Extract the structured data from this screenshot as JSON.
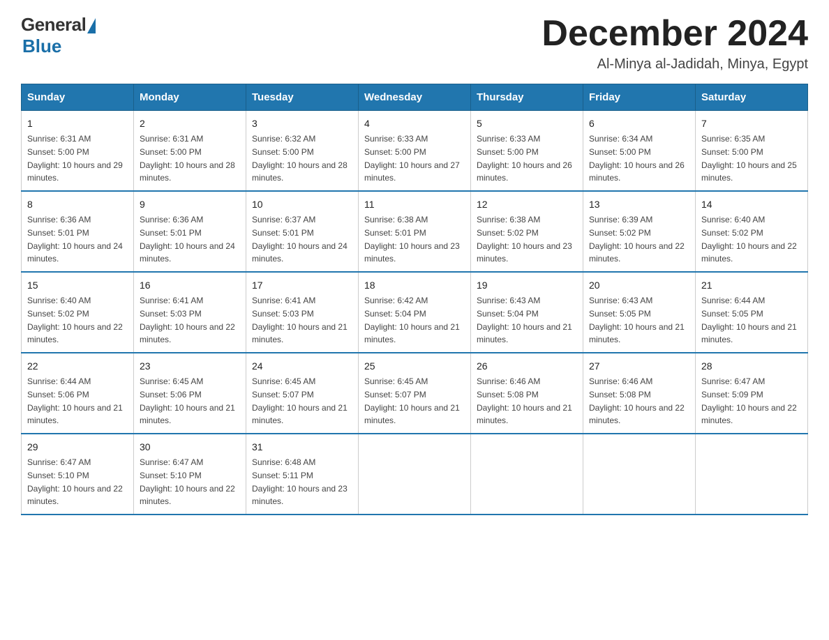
{
  "logo": {
    "general": "General",
    "blue": "Blue"
  },
  "header": {
    "month_title": "December 2024",
    "location": "Al-Minya al-Jadidah, Minya, Egypt"
  },
  "days_of_week": [
    "Sunday",
    "Monday",
    "Tuesday",
    "Wednesday",
    "Thursday",
    "Friday",
    "Saturday"
  ],
  "weeks": [
    [
      {
        "day": "1",
        "sunrise": "6:31 AM",
        "sunset": "5:00 PM",
        "daylight": "10 hours and 29 minutes."
      },
      {
        "day": "2",
        "sunrise": "6:31 AM",
        "sunset": "5:00 PM",
        "daylight": "10 hours and 28 minutes."
      },
      {
        "day": "3",
        "sunrise": "6:32 AM",
        "sunset": "5:00 PM",
        "daylight": "10 hours and 28 minutes."
      },
      {
        "day": "4",
        "sunrise": "6:33 AM",
        "sunset": "5:00 PM",
        "daylight": "10 hours and 27 minutes."
      },
      {
        "day": "5",
        "sunrise": "6:33 AM",
        "sunset": "5:00 PM",
        "daylight": "10 hours and 26 minutes."
      },
      {
        "day": "6",
        "sunrise": "6:34 AM",
        "sunset": "5:00 PM",
        "daylight": "10 hours and 26 minutes."
      },
      {
        "day": "7",
        "sunrise": "6:35 AM",
        "sunset": "5:00 PM",
        "daylight": "10 hours and 25 minutes."
      }
    ],
    [
      {
        "day": "8",
        "sunrise": "6:36 AM",
        "sunset": "5:01 PM",
        "daylight": "10 hours and 24 minutes."
      },
      {
        "day": "9",
        "sunrise": "6:36 AM",
        "sunset": "5:01 PM",
        "daylight": "10 hours and 24 minutes."
      },
      {
        "day": "10",
        "sunrise": "6:37 AM",
        "sunset": "5:01 PM",
        "daylight": "10 hours and 24 minutes."
      },
      {
        "day": "11",
        "sunrise": "6:38 AM",
        "sunset": "5:01 PM",
        "daylight": "10 hours and 23 minutes."
      },
      {
        "day": "12",
        "sunrise": "6:38 AM",
        "sunset": "5:02 PM",
        "daylight": "10 hours and 23 minutes."
      },
      {
        "day": "13",
        "sunrise": "6:39 AM",
        "sunset": "5:02 PM",
        "daylight": "10 hours and 22 minutes."
      },
      {
        "day": "14",
        "sunrise": "6:40 AM",
        "sunset": "5:02 PM",
        "daylight": "10 hours and 22 minutes."
      }
    ],
    [
      {
        "day": "15",
        "sunrise": "6:40 AM",
        "sunset": "5:02 PM",
        "daylight": "10 hours and 22 minutes."
      },
      {
        "day": "16",
        "sunrise": "6:41 AM",
        "sunset": "5:03 PM",
        "daylight": "10 hours and 22 minutes."
      },
      {
        "day": "17",
        "sunrise": "6:41 AM",
        "sunset": "5:03 PM",
        "daylight": "10 hours and 21 minutes."
      },
      {
        "day": "18",
        "sunrise": "6:42 AM",
        "sunset": "5:04 PM",
        "daylight": "10 hours and 21 minutes."
      },
      {
        "day": "19",
        "sunrise": "6:43 AM",
        "sunset": "5:04 PM",
        "daylight": "10 hours and 21 minutes."
      },
      {
        "day": "20",
        "sunrise": "6:43 AM",
        "sunset": "5:05 PM",
        "daylight": "10 hours and 21 minutes."
      },
      {
        "day": "21",
        "sunrise": "6:44 AM",
        "sunset": "5:05 PM",
        "daylight": "10 hours and 21 minutes."
      }
    ],
    [
      {
        "day": "22",
        "sunrise": "6:44 AM",
        "sunset": "5:06 PM",
        "daylight": "10 hours and 21 minutes."
      },
      {
        "day": "23",
        "sunrise": "6:45 AM",
        "sunset": "5:06 PM",
        "daylight": "10 hours and 21 minutes."
      },
      {
        "day": "24",
        "sunrise": "6:45 AM",
        "sunset": "5:07 PM",
        "daylight": "10 hours and 21 minutes."
      },
      {
        "day": "25",
        "sunrise": "6:45 AM",
        "sunset": "5:07 PM",
        "daylight": "10 hours and 21 minutes."
      },
      {
        "day": "26",
        "sunrise": "6:46 AM",
        "sunset": "5:08 PM",
        "daylight": "10 hours and 21 minutes."
      },
      {
        "day": "27",
        "sunrise": "6:46 AM",
        "sunset": "5:08 PM",
        "daylight": "10 hours and 22 minutes."
      },
      {
        "day": "28",
        "sunrise": "6:47 AM",
        "sunset": "5:09 PM",
        "daylight": "10 hours and 22 minutes."
      }
    ],
    [
      {
        "day": "29",
        "sunrise": "6:47 AM",
        "sunset": "5:10 PM",
        "daylight": "10 hours and 22 minutes."
      },
      {
        "day": "30",
        "sunrise": "6:47 AM",
        "sunset": "5:10 PM",
        "daylight": "10 hours and 22 minutes."
      },
      {
        "day": "31",
        "sunrise": "6:48 AM",
        "sunset": "5:11 PM",
        "daylight": "10 hours and 23 minutes."
      },
      null,
      null,
      null,
      null
    ]
  ]
}
